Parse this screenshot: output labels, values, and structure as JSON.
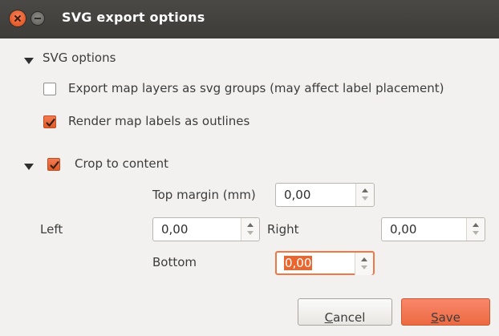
{
  "window": {
    "title": "SVG export options",
    "controls": [
      "close-icon",
      "minimize-icon"
    ]
  },
  "svg_options": {
    "section_label": "SVG options",
    "export_layers_label": "Export map layers as svg groups (may affect label placement)",
    "export_layers_checked": false,
    "render_labels_label": "Render map labels as outlines",
    "render_labels_checked": true
  },
  "crop": {
    "section_label": "Crop to content",
    "checked": true,
    "top_label": "Top margin (mm)",
    "top_value": "0,00",
    "left_label": "Left",
    "left_value": "0,00",
    "right_label": "Right",
    "right_value": "0,00",
    "bottom_label": "Bottom",
    "bottom_value": "0,00"
  },
  "buttons": {
    "cancel_label_mnemonic": "C",
    "cancel_label_rest": "ancel",
    "save_label_mnemonic": "S",
    "save_label_rest": "ave"
  },
  "colors": {
    "accent": "#ec6a3f",
    "titlebar": "#3d3c38",
    "background": "#f2f1f0"
  }
}
